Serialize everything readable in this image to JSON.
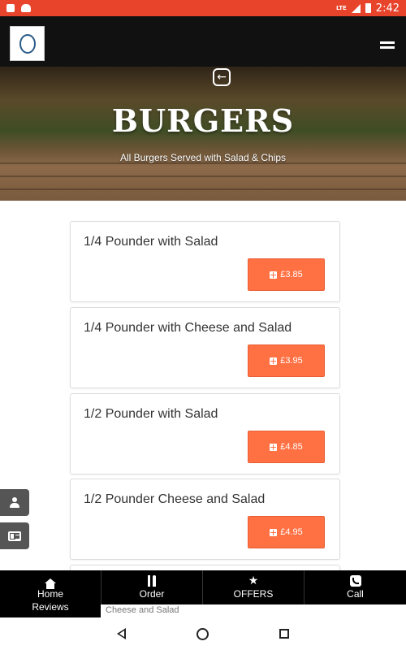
{
  "status_bar": {
    "network": "LTE",
    "time": "2:42"
  },
  "header": {
    "logo_alt": "The Manor Place"
  },
  "hero": {
    "title": "BURGERS",
    "subtitle": "All Burgers Served with Salad & Chips"
  },
  "items": [
    {
      "name": "1/4 Pounder with Salad",
      "price": "£3.85"
    },
    {
      "name": "1/4 Pounder with Cheese and Salad",
      "price": "£3.95"
    },
    {
      "name": "1/2 Pounder with Salad",
      "price": "£4.85"
    },
    {
      "name": "1/2 Pounder Cheese and Salad",
      "price": "£4.95"
    }
  ],
  "nav": [
    {
      "label": "Home",
      "sub": "Reviews",
      "icon": "home-icon"
    },
    {
      "label": "Order",
      "icon": "cutlery-icon"
    },
    {
      "label": "OFFERS",
      "icon": "star-icon"
    },
    {
      "label": "Call",
      "icon": "phone-icon"
    }
  ],
  "peek_text": "Cheese and Salad",
  "colors": {
    "accent": "#ff7043",
    "status_bar": "#e8432b",
    "nav_bg": "#000000",
    "app_bar": "#111111"
  }
}
